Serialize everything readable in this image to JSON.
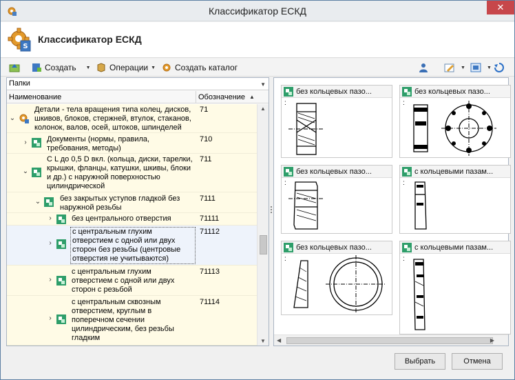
{
  "window": {
    "title": "Классификатор ЕСКД",
    "close_glyph": "✕"
  },
  "header": {
    "title": "Классификатор ЕСКД",
    "logo_icon": "gear-document-icon"
  },
  "toolbar": {
    "create_label": "Создать",
    "operations_label": "Операции",
    "create_catalog_label": "Создать каталог"
  },
  "folders": {
    "label": "Папки"
  },
  "columns": {
    "name": "Наименование",
    "code": "Обозначение"
  },
  "tree": [
    {
      "lines": [
        "Детали - тела вращения типа колец, дисков,",
        "шкивов, блоков, стержней, втулок, стаканов,",
        "колонок, валов, осей, штоков, шпинделей"
      ],
      "code": "71"
    },
    {
      "lines": [
        "Документы (нормы, правила,",
        "требования, методы)"
      ],
      "code": "710"
    },
    {
      "lines": [
        "С L до 0,5 D вкл. (кольца, диски, тарелки,",
        "крышки, фланцы, катушки, шкивы, блоки",
        "и др.) с наружной поверхностью",
        "цилиндрической"
      ],
      "code": "711"
    },
    {
      "lines": [
        "без закрытых уступов гладкой без",
        "наружной резьбы"
      ],
      "code": "7111"
    },
    {
      "lines": [
        "без центрального отверстия"
      ],
      "code": "71111"
    },
    {
      "lines": [
        "с центральным глухим",
        "отверстием с одной или двух",
        "сторон без резьбы (центровые",
        "отверстия не учитываются)"
      ],
      "code": "71112"
    },
    {
      "lines": [
        "с центральным глухим",
        "отверстием с одной или двух",
        "сторон с резьбой"
      ],
      "code": "71113"
    },
    {
      "lines": [
        "с центральным сквозным",
        "отверстием, круглым в",
        "поперечном сечении",
        "цилиндрическим, без резьбы",
        "гладким"
      ],
      "code": "71114"
    }
  ],
  "cards": [
    {
      "title": "без кольцевых пазо...",
      "dot": ":"
    },
    {
      "title": "без кольцевых пазо...",
      "dot": ":"
    },
    {
      "title": "без кольцевых пазо...",
      "dot": ":"
    },
    {
      "title": "с кольцевыми пазам...",
      "dot": ":"
    },
    {
      "title": "без кольцевых пазо...",
      "dot": ":"
    },
    {
      "title": "с кольцевыми пазам...",
      "dot": ":"
    }
  ],
  "buttons": {
    "select": "Выбрать",
    "cancel": "Отмена"
  }
}
